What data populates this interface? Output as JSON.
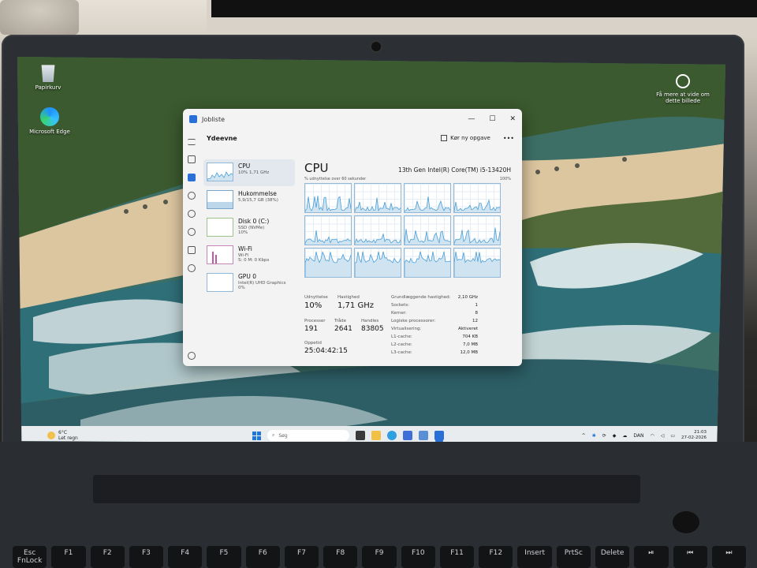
{
  "desktop": {
    "icons": [
      {
        "label": "Papirkurv",
        "icon": "recycle-bin-icon"
      },
      {
        "label": "Microsoft Edge",
        "icon": "edge-icon"
      }
    ],
    "spotlight_text": "Få mere at vide om dette billede"
  },
  "window": {
    "title": "Jobliste",
    "controls": [
      "—",
      "☐",
      "✕"
    ]
  },
  "toolbar": {
    "section_title": "Ydeevne",
    "run_task": "Kør ny opgave",
    "more": "•••"
  },
  "devices": [
    {
      "name": "CPU",
      "line2": "10% 1,71 GHz",
      "line3": ""
    },
    {
      "name": "Hukommelse",
      "line2": "5,9/15,7 GB (38%)",
      "line3": ""
    },
    {
      "name": "Disk 0 (C:)",
      "line2": "SSD (NVMe)",
      "line3": "10%"
    },
    {
      "name": "Wi-Fi",
      "line2": "Wi-Fi",
      "line3": "S: 0 M: 0 Kbps"
    },
    {
      "name": "GPU 0",
      "line2": "Intel(R) UHD Graphics",
      "line3": "0%"
    }
  ],
  "cpu_panel": {
    "heading": "CPU",
    "model": "13th Gen Intel(R) Core(TM) i5-13420H",
    "graph_caption": "% udnyttelse over 60 sekunder",
    "graph_max": "100%",
    "usage_labels": {
      "utilization": "Udnyttelse",
      "speed": "Hastighed",
      "processes": "Processer",
      "threads": "Tråde",
      "handles": "Handles",
      "uptime": "Oppetid"
    },
    "usage_values": {
      "utilization": "10%",
      "speed": "1,71 GHz",
      "processes": "191",
      "threads": "2641",
      "handles": "83805",
      "uptime": "25:04:42:15"
    },
    "specs": [
      {
        "label": "Grundlæggende hastighed:",
        "value": "2,10 GHz"
      },
      {
        "label": "Sockets:",
        "value": "1"
      },
      {
        "label": "Kerner:",
        "value": "8"
      },
      {
        "label": "Logiske processorer:",
        "value": "12"
      },
      {
        "label": "Virtualisering:",
        "value": "Aktiveret"
      },
      {
        "label": "L1-cache:",
        "value": "704 KB"
      },
      {
        "label": "L2-cache:",
        "value": "7,0 MB"
      },
      {
        "label": "L3-cache:",
        "value": "12,0 MB"
      }
    ]
  },
  "taskbar": {
    "weather_temp": "6°C",
    "weather_text": "Let regn",
    "search_placeholder": "Søg",
    "language": "DAN",
    "time": "21:03",
    "date": "27-02-2026"
  },
  "keyboard": [
    "Esc FnLock",
    "F1",
    "F2",
    "F3",
    "F4",
    "F5",
    "F6",
    "F7",
    "F8",
    "F9",
    "F10",
    "F11",
    "F12",
    "Insert",
    "PrtSc",
    "Delete",
    "⏯",
    "⏮",
    "⏭"
  ],
  "colors": {
    "accent": "#2a6fd6",
    "cpu_graph": "#4a9fd6",
    "cpu_fill": "#cfe3f1",
    "wifi": "#c05aa6",
    "disk": "#8bbd6e"
  }
}
